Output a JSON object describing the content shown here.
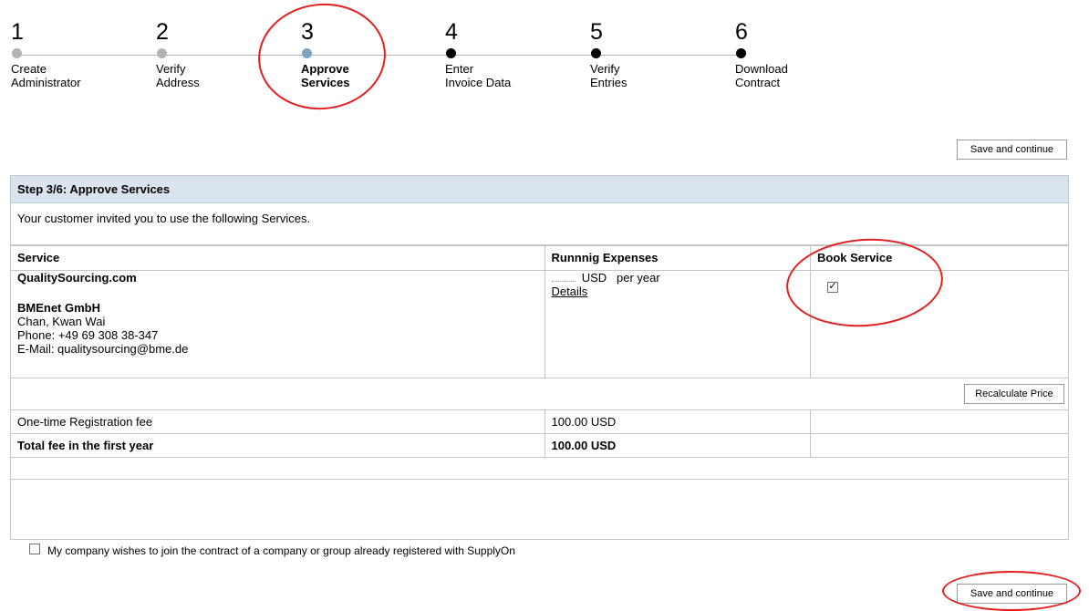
{
  "stepper": {
    "steps": [
      {
        "num": "1",
        "line1": "Create",
        "line2": "Administrator"
      },
      {
        "num": "2",
        "line1": "Verify",
        "line2": "Address"
      },
      {
        "num": "3",
        "line1": "Approve",
        "line2": "Services"
      },
      {
        "num": "4",
        "line1": "Enter",
        "line2": "Invoice Data"
      },
      {
        "num": "5",
        "line1": "Verify",
        "line2": "Entries"
      },
      {
        "num": "6",
        "line1": "Download",
        "line2": "Contract"
      }
    ],
    "current_step": 3
  },
  "buttons": {
    "save_top": "Save and continue",
    "save_bottom": "Save and continue",
    "recalculate": "Recalculate Price"
  },
  "panel": {
    "title": "Step 3/6: Approve Services",
    "intro": "Your customer invited you to use the following Services.",
    "columns": {
      "service": "Service",
      "expenses": "Runnnig Expenses",
      "book": "Book Service"
    },
    "service": {
      "name": "QualitySourcing.com",
      "company": "BMEnet GmbH",
      "contact": "Chan, Kwan Wai",
      "phone": "Phone: +49 69 308 38-347",
      "email": "E-Mail: qualitysourcing@bme.de",
      "currency": "USD",
      "period": "per year",
      "details_link": "Details",
      "booked": true
    },
    "fees": [
      {
        "label": "One-time Registration fee",
        "amount": "100.00 USD",
        "bold": false
      },
      {
        "label": "Total fee in the first year",
        "amount": "100.00 USD",
        "bold": true
      }
    ],
    "join_contract": {
      "label": "My company wishes to join the contract of a company or group already registered with SupplyOn",
      "checked": false
    }
  },
  "colors": {
    "header_bg": "#d9e5ee",
    "annotation": "#e32020",
    "current_dot": "#7ea5c3"
  }
}
